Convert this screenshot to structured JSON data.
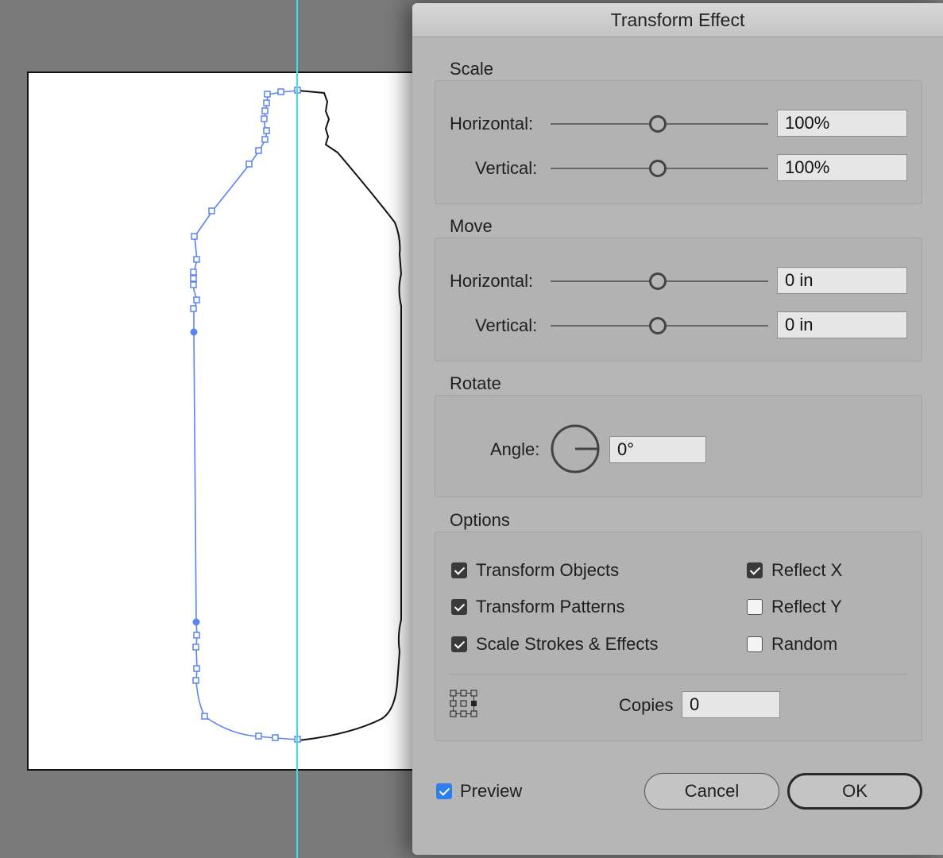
{
  "dialog": {
    "title": "Transform Effect"
  },
  "scale": {
    "title": "Scale",
    "horizontal_label": "Horizontal:",
    "horizontal_value": "100%",
    "vertical_label": "Vertical:",
    "vertical_value": "100%"
  },
  "move": {
    "title": "Move",
    "horizontal_label": "Horizontal:",
    "horizontal_value": "0 in",
    "vertical_label": "Vertical:",
    "vertical_value": "0 in"
  },
  "rotate": {
    "title": "Rotate",
    "angle_label": "Angle:",
    "angle_value": "0°"
  },
  "options": {
    "title": "Options",
    "transform_objects": {
      "label": "Transform Objects",
      "checked": true
    },
    "transform_patterns": {
      "label": "Transform Patterns",
      "checked": true
    },
    "scale_strokes": {
      "label": "Scale Strokes & Effects",
      "checked": true
    },
    "reflect_x": {
      "label": "Reflect X",
      "checked": true
    },
    "reflect_y": {
      "label": "Reflect Y",
      "checked": false
    },
    "random": {
      "label": "Random",
      "checked": false
    },
    "copies_label": "Copies",
    "copies_value": "0",
    "reference_point_icon": "reference-point-grid-icon"
  },
  "footer": {
    "preview": {
      "label": "Preview",
      "checked": true
    },
    "cancel_label": "Cancel",
    "ok_label": "OK"
  },
  "colors": {
    "guide": "#35e3e6",
    "selection_path": "#5b84f0",
    "preview_check": "#2f7ef0"
  }
}
